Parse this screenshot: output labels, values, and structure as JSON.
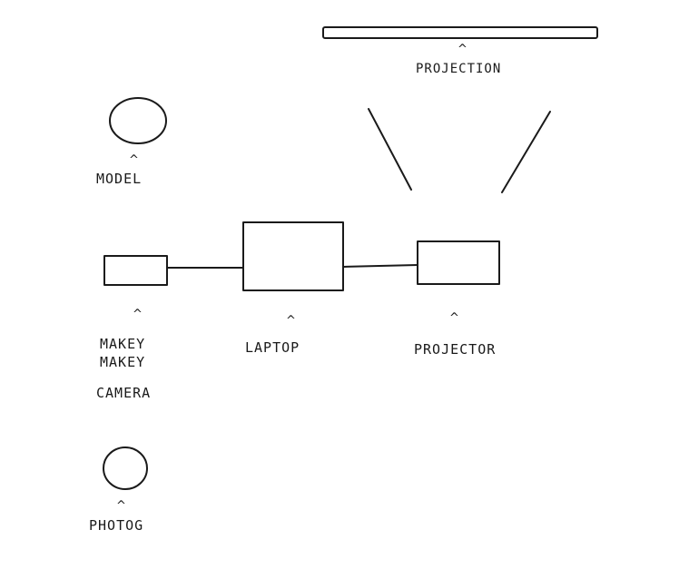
{
  "diagram": {
    "labels": {
      "projection": "PROJECTION",
      "model": "MODEL",
      "makey_line1": "MAKEY",
      "makey_line2": "MAKEY",
      "camera": "CAMERA",
      "laptop": "LAPTOP",
      "projector": "PROJECTOR",
      "photog": "PHOTOG"
    },
    "pointer_glyph": "^",
    "ink_color": "#1a1a1a",
    "background_color": "#ffffff"
  }
}
